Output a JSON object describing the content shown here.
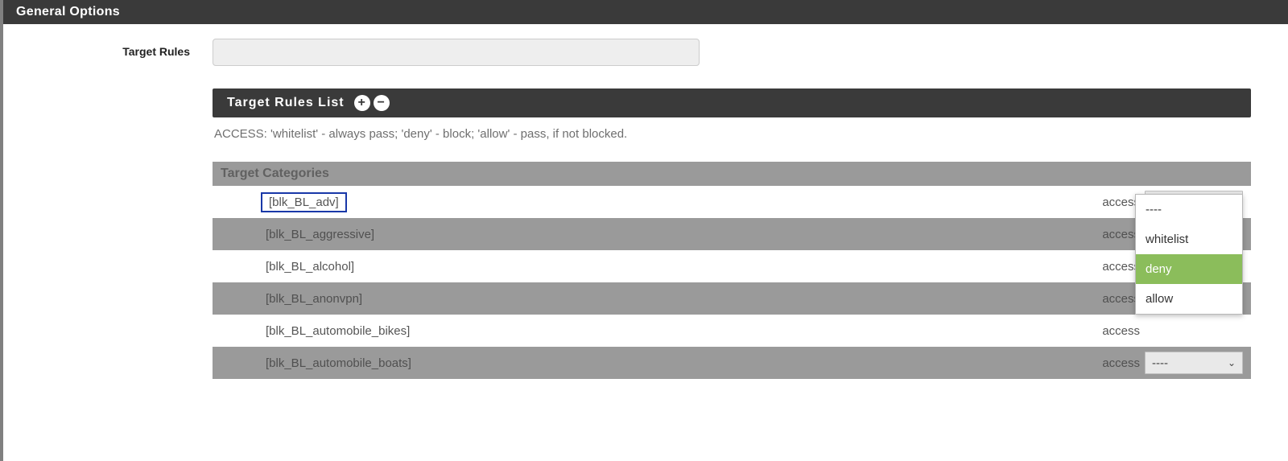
{
  "header": {
    "title": "General Options"
  },
  "form": {
    "target_rules_label": "Target Rules",
    "target_rules_value": ""
  },
  "list_header": {
    "title": "Target Rules List"
  },
  "hint_text": "ACCESS: 'whitelist' - always pass; 'deny' - block; 'allow' - pass, if not blocked.",
  "table": {
    "header": "Target Categories",
    "access_label": "access",
    "rows": [
      {
        "name": "[blk_BL_adv]",
        "value": "deny",
        "highlight": true
      },
      {
        "name": "[blk_BL_aggressive]",
        "value": "",
        "highlight": false
      },
      {
        "name": "[blk_BL_alcohol]",
        "value": "",
        "highlight": false
      },
      {
        "name": "[blk_BL_anonvpn]",
        "value": "",
        "highlight": false
      },
      {
        "name": "[blk_BL_automobile_bikes]",
        "value": "",
        "highlight": false
      },
      {
        "name": "[blk_BL_automobile_boats]",
        "value": "----",
        "highlight": false
      }
    ]
  },
  "dropdown": {
    "options": [
      "----",
      "whitelist",
      "deny",
      "allow"
    ],
    "selected": "deny"
  },
  "glyphs": {
    "chevron_down": "⌄",
    "plus": "+",
    "minus": "−",
    "dash4": "----"
  }
}
